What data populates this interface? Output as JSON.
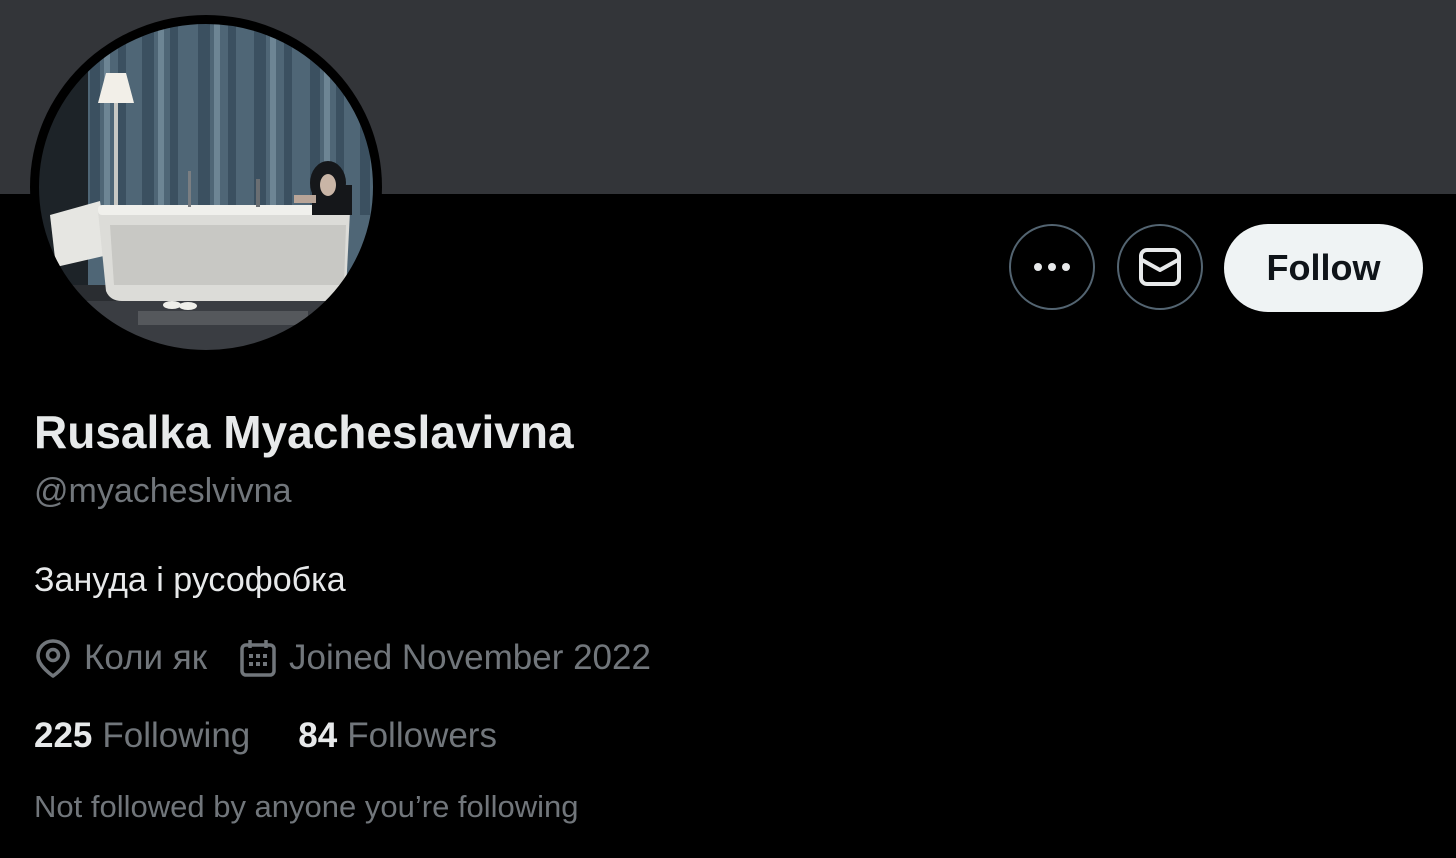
{
  "profile": {
    "display_name": "Rusalka Myacheslavivna",
    "handle": "@myacheslvivna",
    "bio": "Зануда і русофобка",
    "location": "Коли як",
    "joined": "Joined November 2022",
    "following_count": "225",
    "following_label": "Following",
    "followers_count": "84",
    "followers_label": "Followers",
    "mutuals_note": "Not followed by anyone you’re following"
  },
  "actions": {
    "more_icon": "more-horizontal-icon",
    "message_icon": "envelope-icon",
    "follow_label": "Follow"
  },
  "meta_icons": {
    "location": "map-pin-icon",
    "joined": "calendar-icon"
  },
  "colors": {
    "background": "#000000",
    "banner": "#333539",
    "primary_text": "#e7e9ea",
    "secondary_text": "#71767b",
    "button_border": "#536471",
    "follow_button_bg": "#eff3f4",
    "follow_button_text": "#0f1419"
  }
}
